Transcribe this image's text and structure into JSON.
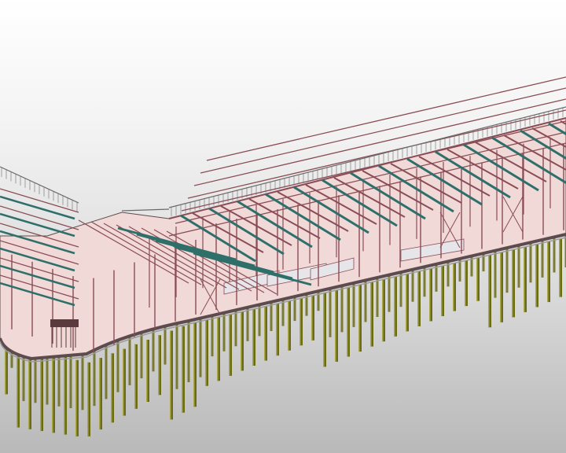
{
  "scene": {
    "kind": "3d-structural-model",
    "background_top": "#ffffff",
    "background_bottom": "#b9b9b9",
    "colors": {
      "steel_frame": "#8a4c55",
      "floor_beam": "#2f6f6a",
      "slab_fill": "#f1d9d8",
      "slab_edge": "#5d4b4d",
      "pile": "#6b6b16",
      "pile_highlight": "#a8a84a",
      "railing": "#6a6a6a",
      "panel": "#e6e6ea"
    },
    "elements": [
      "piles",
      "floor-slab",
      "steel-frame",
      "roof-beams",
      "railing",
      "stair"
    ]
  }
}
